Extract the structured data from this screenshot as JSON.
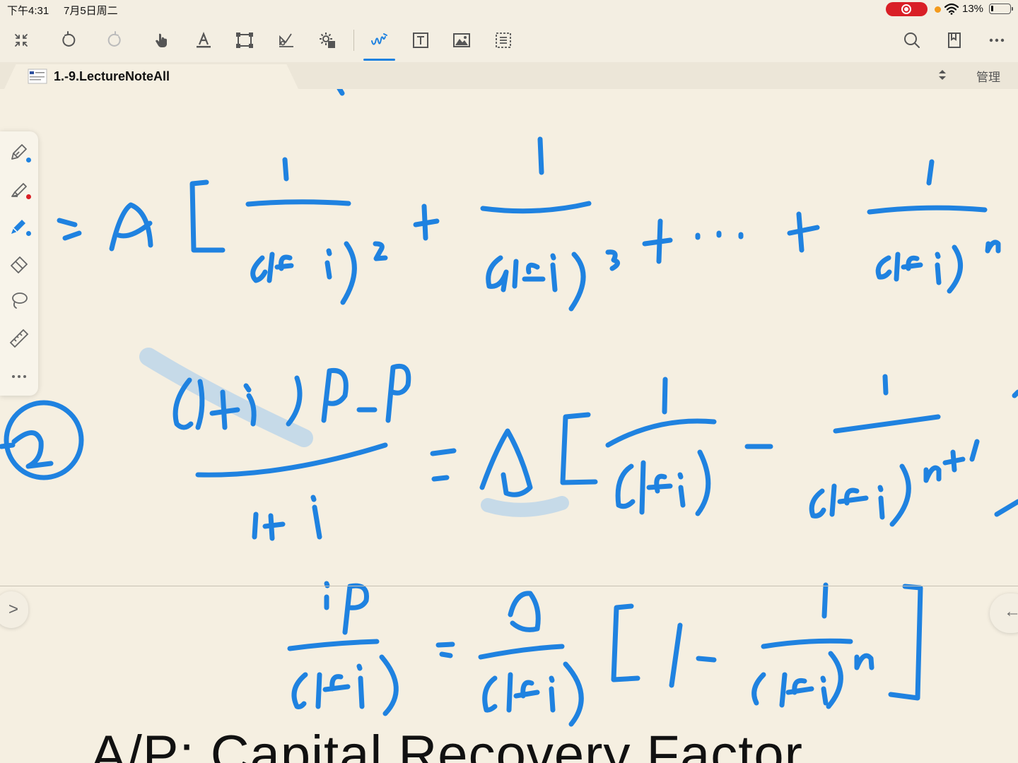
{
  "status_bar": {
    "time": "下午4:31",
    "date": "7月5日周二",
    "battery_percent": "13%",
    "battery_level": 0.13,
    "recording_color": "#d91f26"
  },
  "toolbar": {
    "left_tools": [
      "collapse-icon",
      "undo-icon",
      "redo-icon",
      "hand-tool-icon",
      "text-format-icon",
      "page-frame-icon",
      "diagram-icon",
      "settings-icon"
    ],
    "right_tools": [
      "handwriting-icon",
      "text-box-icon",
      "image-icon",
      "selection-icon"
    ],
    "active_tool": "handwriting-icon",
    "accent_color": "#1f82e0",
    "actions": [
      "search-icon",
      "bookmark-icon",
      "more-icon"
    ]
  },
  "tab_bar": {
    "document_title": "1.-9.LectureNoteAll",
    "manage_label": "管理"
  },
  "palette": {
    "tools": [
      "pen-icon",
      "highlighter-icon",
      "marker-icon",
      "eraser-icon",
      "lasso-icon",
      "ruler-icon",
      "more-dots-icon"
    ],
    "selected_tool": "marker-icon",
    "dot_colors": [
      "#1f82e0",
      "#d91f26",
      "#1f82e0"
    ]
  },
  "canvas": {
    "ink_color": "#1f82e0",
    "slide_title": "A/P: Capital Recovery Factor"
  },
  "side_handles": {
    "left_glyph": ">",
    "right_glyph": "←"
  }
}
